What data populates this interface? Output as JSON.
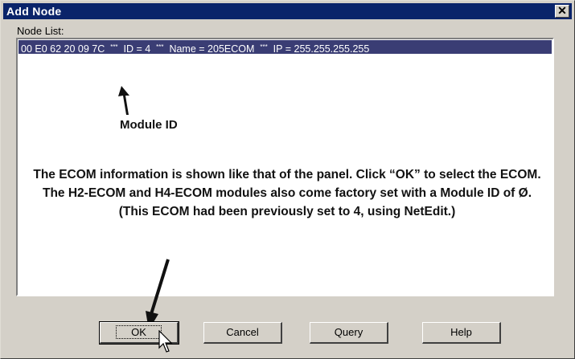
{
  "window": {
    "title": "Add Node",
    "close_glyph": "✕"
  },
  "node_list": {
    "label": "Node List:",
    "items": [
      {
        "mac": "00 E0 62 20 09 7C",
        "sep": "***",
        "id_text": "ID = 4",
        "name_text": "Name = 205ECOM",
        "ip_text": "IP = 255.255.255.255",
        "selected": true
      }
    ]
  },
  "annotations": {
    "module_id_label": "Module ID",
    "description": "The ECOM information is shown like that of the panel. Click “OK” to select the ECOM. The H2-ECOM and H4-ECOM modules also come factory set with a Module ID of Ø. (This ECOM had been previously set to 4, using NetEdit.)"
  },
  "buttons": {
    "ok": "OK",
    "cancel": "Cancel",
    "query": "Query",
    "help": "Help"
  },
  "icons": [
    "close-icon",
    "mouse-pointer-icon",
    "arrow-up-annotation",
    "arrow-down-annotation"
  ],
  "colors": {
    "title_bar": "#0a246a",
    "selection": "#3a3d74",
    "dialog_face": "#d4d0c8"
  }
}
